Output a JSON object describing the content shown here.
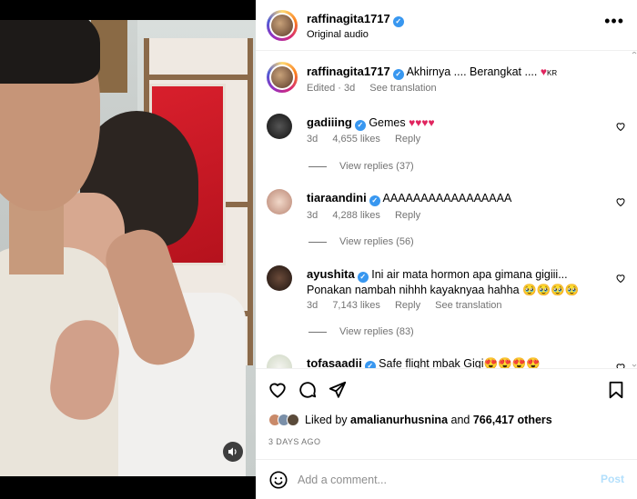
{
  "post": {
    "author": "raffinagita1717",
    "audio": "Original audio",
    "caption_user": "raffinagita1717",
    "caption_text": "Akhirnya .... Berangkat ....",
    "caption_suffix": "KR",
    "caption_meta": "Edited · 3d",
    "see_translation": "See translation"
  },
  "comments": [
    {
      "user": "gadiiing",
      "text": "Gemes",
      "hearts": "♥♥♥♥",
      "age": "3d",
      "likes": "4,655 likes",
      "reply": "Reply",
      "view_replies": "View replies (37)"
    },
    {
      "user": "tiaraandini",
      "text": "AAAAAAAAAAAAAAAAA",
      "hearts": "",
      "age": "3d",
      "likes": "4,288 likes",
      "reply": "Reply",
      "view_replies": "View replies (56)"
    },
    {
      "user": "ayushita",
      "text": "Ini air mata hormon apa gimana gigiii... Ponakan nambah nihhh kayaknyaa hahha 🥹🥹🥹🥹",
      "hearts": "",
      "age": "3d",
      "likes": "7,143 likes",
      "reply": "Reply",
      "translate": "See translation",
      "view_replies": "View replies (83)"
    },
    {
      "user": "tofasaadii",
      "text": "Safe flight mbak Gigi😍😍😍😍",
      "hearts": "",
      "age": "",
      "likes": "",
      "reply": ""
    }
  ],
  "likes": {
    "prefix": "Liked by",
    "user": "amalianurhusnina",
    "and": "and",
    "count": "766,417 others"
  },
  "posted": "3 DAYS AGO",
  "comment_box": {
    "placeholder": "Add a comment...",
    "post": "Post"
  },
  "icons": {
    "more": "more-options-icon",
    "like": "heart-icon",
    "comment": "comment-icon",
    "share": "share-icon",
    "save": "bookmark-icon",
    "emoji": "emoji-icon",
    "audio": "speaker-icon"
  },
  "colors": {
    "verified": "#3897f0",
    "heart": "#e0245e",
    "muted": "#737373",
    "post_disabled": "#b2dffc"
  }
}
